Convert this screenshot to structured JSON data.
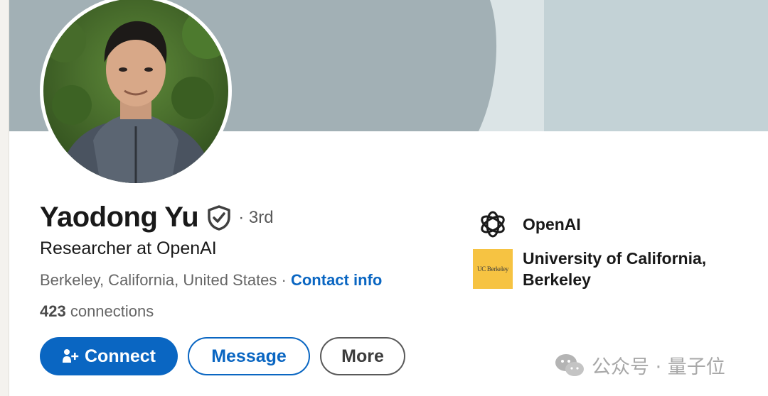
{
  "profile": {
    "name": "Yaodong Yu",
    "degree": "· 3rd",
    "headline": "Researcher at OpenAI",
    "location": "Berkeley, California, United States",
    "separator": " · ",
    "contact_label": "Contact info",
    "connections_count": "423",
    "connections_label": " connections"
  },
  "actions": {
    "connect_label": "Connect",
    "message_label": "Message",
    "more_label": "More"
  },
  "organizations": [
    {
      "name": "OpenAI",
      "icon": "openai-logo"
    },
    {
      "name": "University of California,",
      "name_line2": "Berkeley",
      "logo_text": "UC Berkeley",
      "icon": "uc-berkeley-logo"
    }
  ],
  "watermark": {
    "text": "公众号 · 量子位",
    "icon": "wechat-icon"
  },
  "colors": {
    "accent": "#0a66c2",
    "banner": "#a2b0b5",
    "ucb_gold": "#f6c342"
  }
}
